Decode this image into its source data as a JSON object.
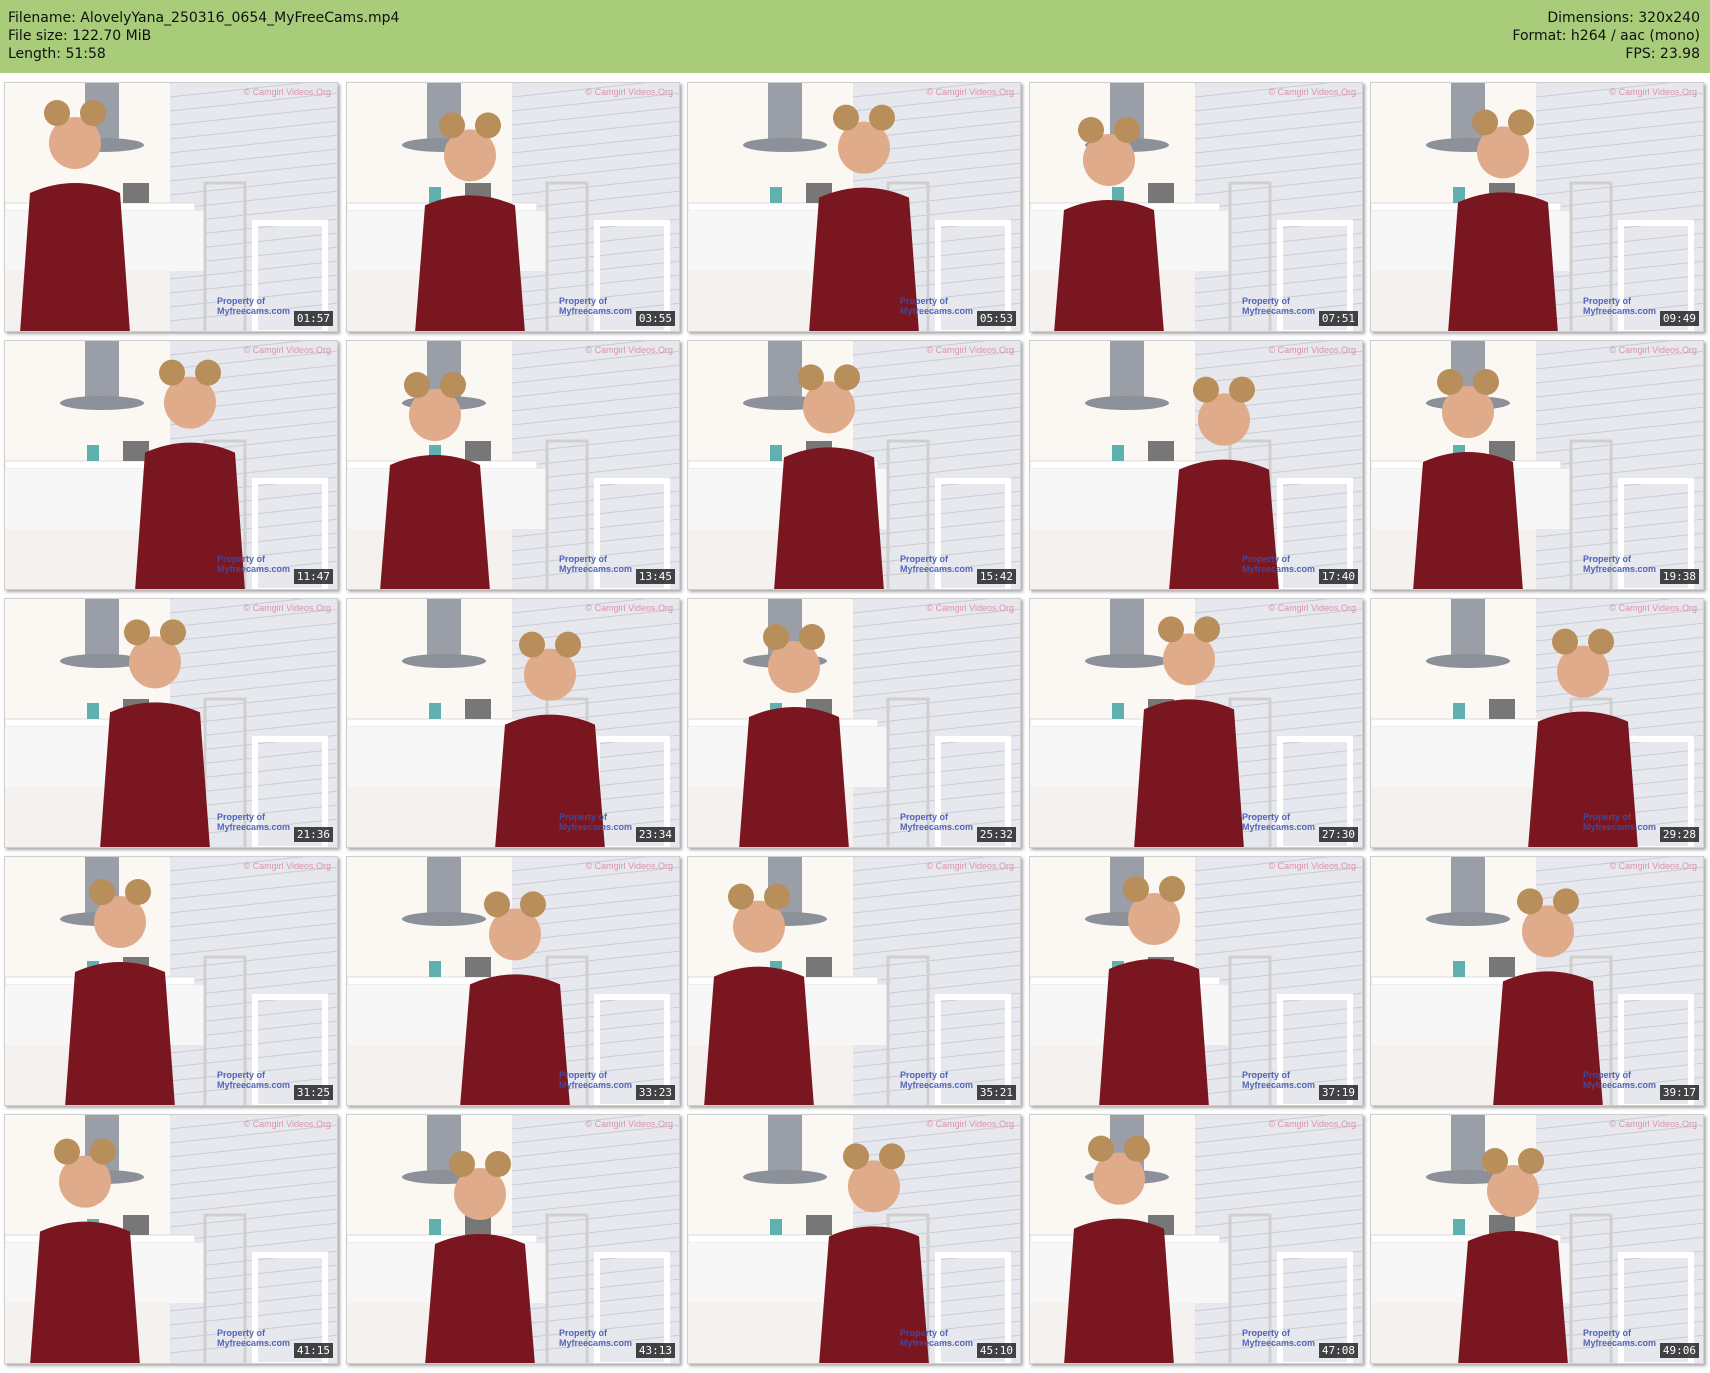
{
  "header": {
    "filename_line": "Filename: AlovelyYana_250316_0654_MyFreeCams.mp4",
    "filesize_line": "File size: 122.70 MiB",
    "length_line": "Length: 51:58",
    "dimensions_line": "Dimensions: 320x240",
    "format_line": "Format: h264 / aac (mono)",
    "fps_line": "FPS: 23.98"
  },
  "watermark": "Property of Myfreecams.com",
  "corner_watermark": "© Camgirl Videos.Org",
  "thumbnails": [
    {
      "timestamp": "01:57"
    },
    {
      "timestamp": "03:55"
    },
    {
      "timestamp": "05:53"
    },
    {
      "timestamp": "07:51"
    },
    {
      "timestamp": "09:49"
    },
    {
      "timestamp": "11:47"
    },
    {
      "timestamp": "13:45"
    },
    {
      "timestamp": "15:42"
    },
    {
      "timestamp": "17:40"
    },
    {
      "timestamp": "19:38"
    },
    {
      "timestamp": "21:36"
    },
    {
      "timestamp": "23:34"
    },
    {
      "timestamp": "25:32"
    },
    {
      "timestamp": "27:30"
    },
    {
      "timestamp": "29:28"
    },
    {
      "timestamp": "31:25"
    },
    {
      "timestamp": "33:23"
    },
    {
      "timestamp": "35:21"
    },
    {
      "timestamp": "37:19"
    },
    {
      "timestamp": "39:17"
    },
    {
      "timestamp": "41:15"
    },
    {
      "timestamp": "43:13"
    },
    {
      "timestamp": "45:10"
    },
    {
      "timestamp": "47:08"
    },
    {
      "timestamp": "49:06"
    }
  ],
  "colors": {
    "header_bg": "#a9cc7a",
    "outfit": "#7a1620",
    "wall": "#eceef2"
  }
}
